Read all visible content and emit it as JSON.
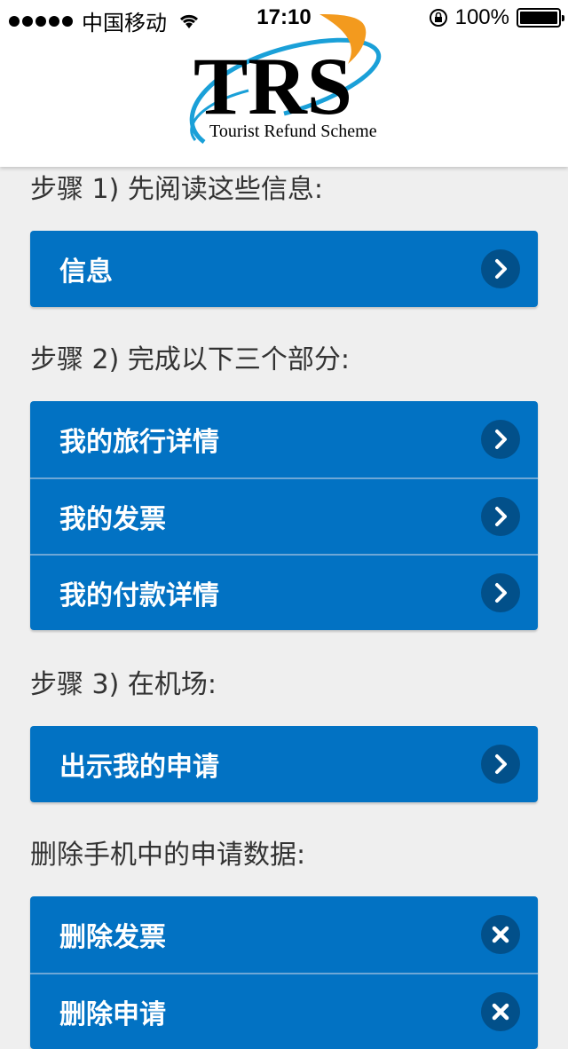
{
  "status_bar": {
    "carrier": "中国移动",
    "time": "17:10",
    "battery": "100%"
  },
  "logo": {
    "letters": "TRS",
    "tagline": "Tourist Refund Scheme",
    "colors": {
      "swoosh_blue": "#1aa0d8",
      "swoosh_orange": "#f39a1e",
      "text": "#000000"
    }
  },
  "steps": [
    {
      "label": "步骤 1) 先阅读这些信息:",
      "items": [
        {
          "label": "信息",
          "icon": "chevron-right-icon"
        }
      ]
    },
    {
      "label": "步骤 2) 完成以下三个部分:",
      "items": [
        {
          "label": "我的旅行详情",
          "icon": "chevron-right-icon"
        },
        {
          "label": "我的发票",
          "icon": "chevron-right-icon"
        },
        {
          "label": "我的付款详情",
          "icon": "chevron-right-icon"
        }
      ]
    },
    {
      "label": "步骤 3) 在机场:",
      "items": [
        {
          "label": "出示我的申请",
          "icon": "chevron-right-icon"
        }
      ]
    },
    {
      "label": "删除手机中的申请数据:",
      "items": [
        {
          "label": "删除发票",
          "icon": "close-icon"
        },
        {
          "label": "删除申请",
          "icon": "close-icon"
        }
      ]
    }
  ],
  "colors": {
    "button_bg": "#0272c3",
    "icon_bg": "#02508a",
    "page_bg": "#efefef"
  }
}
